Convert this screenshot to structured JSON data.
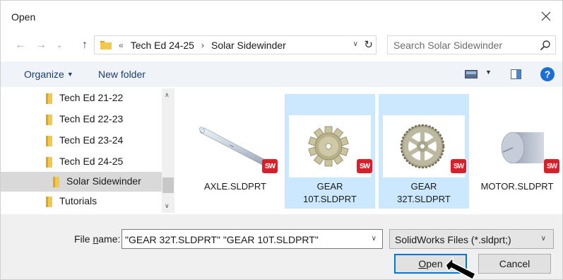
{
  "window": {
    "title": "Open"
  },
  "address": {
    "overflow": "«",
    "crumbs": [
      "Tech Ed 24-25",
      "Solar Sidewinder"
    ],
    "separator": "›"
  },
  "search": {
    "placeholder": "Search Solar Sidewinder"
  },
  "toolbar": {
    "organize": "Organize",
    "new_folder": "New folder",
    "help": "?"
  },
  "nav": {
    "items": [
      {
        "label": "Tech Ed 21-22",
        "selected": false
      },
      {
        "label": "Tech Ed 22-23",
        "selected": false
      },
      {
        "label": "Tech Ed 23-24",
        "selected": false
      },
      {
        "label": "Tech Ed 24-25",
        "selected": false
      },
      {
        "label": "Solar Sidewinder",
        "selected": true
      },
      {
        "label": "Tutorials",
        "selected": false
      }
    ]
  },
  "files": [
    {
      "name": "AXLE.SLDPRT",
      "selected": false,
      "badge": "SW"
    },
    {
      "name": "GEAR 10T.SLDPRT",
      "line1": "GEAR",
      "line2": "10T.SLDPRT",
      "selected": true,
      "badge": "SW"
    },
    {
      "name": "GEAR 32T.SLDPRT",
      "line1": "GEAR",
      "line2": "32T.SLDPRT",
      "selected": true,
      "badge": "SW"
    },
    {
      "name": "MOTOR.SLDPRT",
      "selected": false,
      "badge": "SW"
    }
  ],
  "bottom": {
    "filename_label_prefix": "File ",
    "filename_label_accel": "n",
    "filename_label_suffix": "ame:",
    "filename_value": "\"GEAR 32T.SLDPRT\" \"GEAR 10T.SLDPRT\"",
    "filetype_value": "SolidWorks Files (*.sldprt;)",
    "open_accel": "O",
    "open_rest": "pen",
    "cancel": "Cancel"
  },
  "colors": {
    "selection": "#cce8ff",
    "accent": "#0078d7",
    "folder": "#f2c94c",
    "sw_red": "#d8202a"
  }
}
